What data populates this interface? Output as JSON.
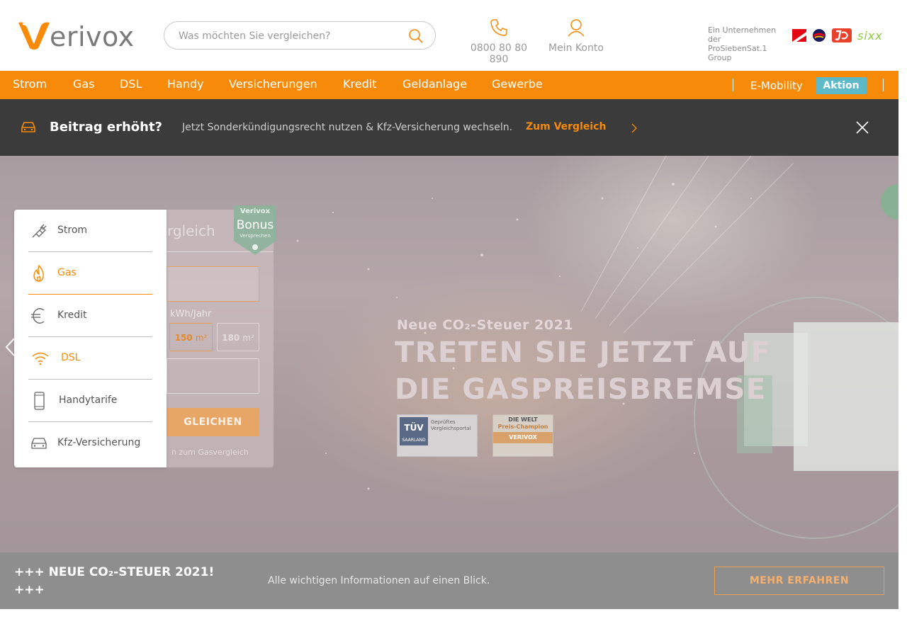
{
  "header": {
    "logo_text": "erivox",
    "search_placeholder": "Was möchten Sie vergleichen?",
    "phone_line1": "0800 80 80",
    "phone_line2": "890",
    "account_label": "Mein Konto",
    "group_line1": "Ein Unternehmen",
    "group_line2": "der",
    "group_line3": "ProSiebenSat.1",
    "group_line4": "Group",
    "brand_sixx": "sixx"
  },
  "nav": {
    "items": [
      "Strom",
      "Gas",
      "DSL",
      "Handy",
      "Versicherungen",
      "Kredit",
      "Geldanlage",
      "Gewerbe"
    ],
    "emobility": "E-Mobility",
    "aktion": "Aktion"
  },
  "banner": {
    "title": "Beitrag erhöht?",
    "description": "Jetzt Sonderkündigungsrecht nutzen & Kfz-Versicherung wechseln.",
    "link": "Zum Vergleich"
  },
  "hero": {
    "subtitle": "Neue CO₂-Steuer 2021",
    "headline_line1": "TRETEN SIE JETZT AUF",
    "headline_line2": "DIE GASPREISBREMSE",
    "form": {
      "title_partial": "rgleich",
      "kwh_label": "kWh/Jahr",
      "size_150": "150",
      "size_180": "180",
      "size_unit": "m²",
      "button_partial": "GLEICHEN",
      "link_partial": "n zum Gasvergleich",
      "bonus_line1": "Verivox",
      "bonus_line2": "Bonus",
      "bonus_line3": "Versprechen"
    },
    "tuv_title": "TÜV",
    "tuv_sub": "SAARLAND",
    "tuv_text": "Geprüftes Vergleichsportal",
    "welt_text": "DIE WELT",
    "welt_sub": "Preis-Champion",
    "welt_brand": "VERIVOX"
  },
  "menu": {
    "items": [
      {
        "label": "Strom",
        "icon": "plug-icon"
      },
      {
        "label": "Gas",
        "icon": "flame-icon"
      },
      {
        "label": "Kredit",
        "icon": "euro-icon"
      },
      {
        "label": "DSL",
        "icon": "wifi-icon"
      },
      {
        "label": "Handytarife",
        "icon": "phone-icon"
      },
      {
        "label": "Kfz-Versicherung",
        "icon": "car-icon"
      }
    ]
  },
  "strip": {
    "title_line1": "+++ NEUE CO₂-STEUER 2021!",
    "title_line2": "+++",
    "description": "Alle wichtigen Informationen auf einen Blick.",
    "button": "MEHR ERFAHREN"
  },
  "colors": {
    "accent": "#f78b09",
    "banner_bg": "#3b3b3b",
    "aktion": "#5db8c8",
    "strip_bg": "#8e8e8e"
  }
}
